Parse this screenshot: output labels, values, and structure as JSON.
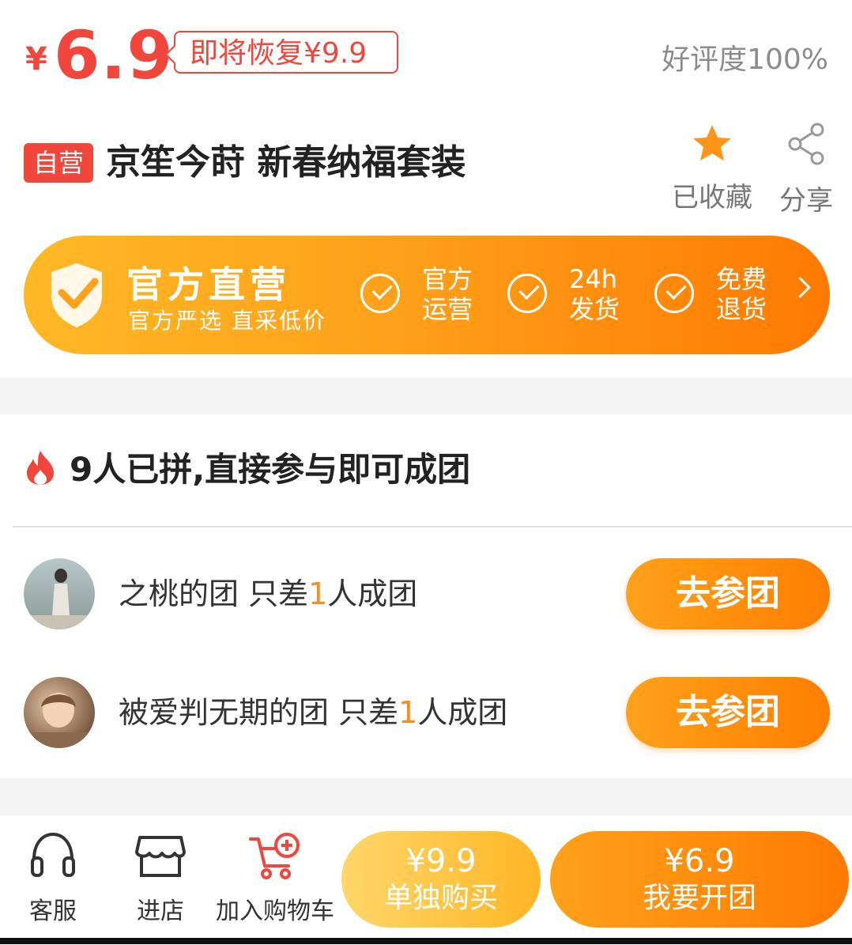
{
  "price": {
    "currency": "¥",
    "amount": "6.9",
    "restore_tag": "即将恢复¥9.9",
    "rating": "好评度100%"
  },
  "product": {
    "badge": "自营",
    "title": "京笙今莳 新春纳福套装",
    "fav_label": "已收藏",
    "share_label": "分享"
  },
  "banner": {
    "title": "官方直营",
    "subtitle": "官方严选 直采低价",
    "features": [
      {
        "line1": "官方",
        "line2": "运营"
      },
      {
        "line1": "24h",
        "line2": "发货"
      },
      {
        "line1": "免费",
        "line2": "退货"
      }
    ]
  },
  "group": {
    "header": "9人已拼,直接参与即可成团",
    "rows": [
      {
        "prefix": "之桃的团 只差",
        "count": "1",
        "suffix": "人成团",
        "button": "去参团"
      },
      {
        "prefix": "被爱判无期的团 只差",
        "count": "1",
        "suffix": "人成团",
        "button": "去参团"
      }
    ]
  },
  "bottom_bar": {
    "service": "客服",
    "store": "进店",
    "cart": "加入购物车",
    "solo_price": "¥9.9",
    "solo_label": "单独购买",
    "group_price": "¥6.9",
    "group_label": "我要开团"
  },
  "colors": {
    "accent_red": "#f0463c",
    "accent_orange": "#ff7a00",
    "highlight": "#ff8a1a"
  },
  "icons": [
    "star-icon",
    "share-icon",
    "shield-check-icon",
    "check-circle-icon",
    "chevron-right-icon",
    "flame-icon",
    "headset-icon",
    "store-icon",
    "cart-add-icon"
  ]
}
